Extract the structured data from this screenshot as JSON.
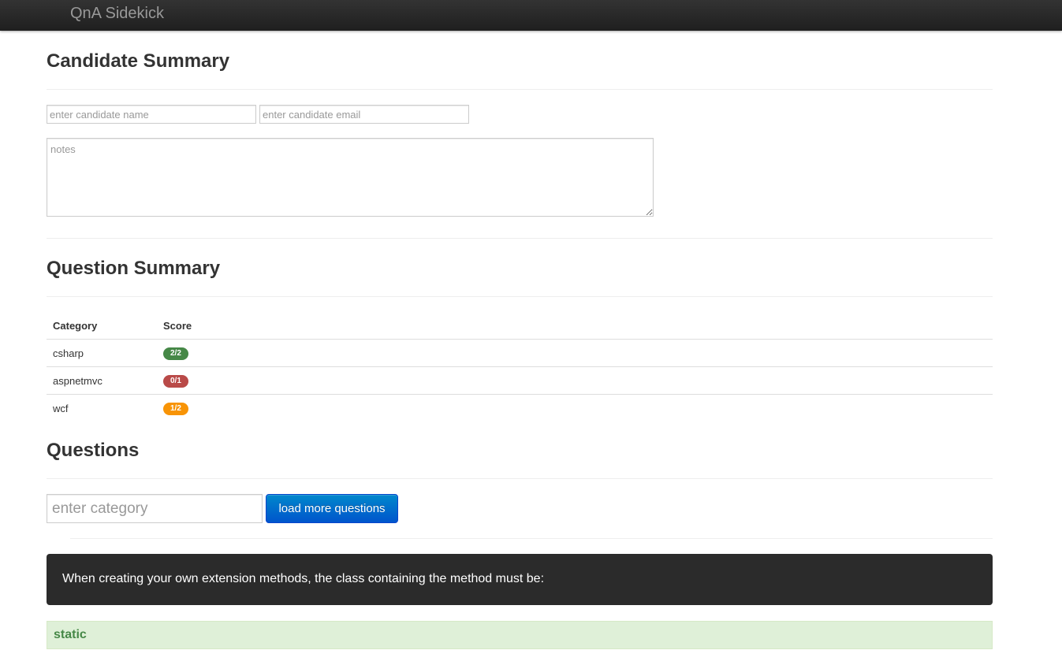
{
  "app": {
    "brand": "QnA Sidekick"
  },
  "candidate": {
    "heading": "Candidate Summary",
    "name_placeholder": "enter candidate name",
    "email_placeholder": "enter candidate email",
    "notes_placeholder": "notes"
  },
  "question_summary": {
    "heading": "Question Summary",
    "columns": [
      "Category",
      "Score"
    ],
    "rows": [
      {
        "category": "csharp",
        "score": "2/2",
        "color": "#468847"
      },
      {
        "category": "aspnetmvc",
        "score": "0/1",
        "color": "#b94a48"
      },
      {
        "category": "wcf",
        "score": "1/2",
        "color": "#f89406"
      }
    ]
  },
  "questions": {
    "heading": "Questions",
    "category_placeholder": "enter category",
    "load_button": "load more questions",
    "current_question": "When creating your own extension methods, the class containing the method must be:",
    "answers": [
      "static"
    ]
  },
  "colors": {
    "primary": "#0074cc",
    "success": "#468847",
    "danger": "#b94a48",
    "warning": "#f89406",
    "question_bg": "#2b2b2b",
    "answer_bg": "#dff0d8"
  }
}
